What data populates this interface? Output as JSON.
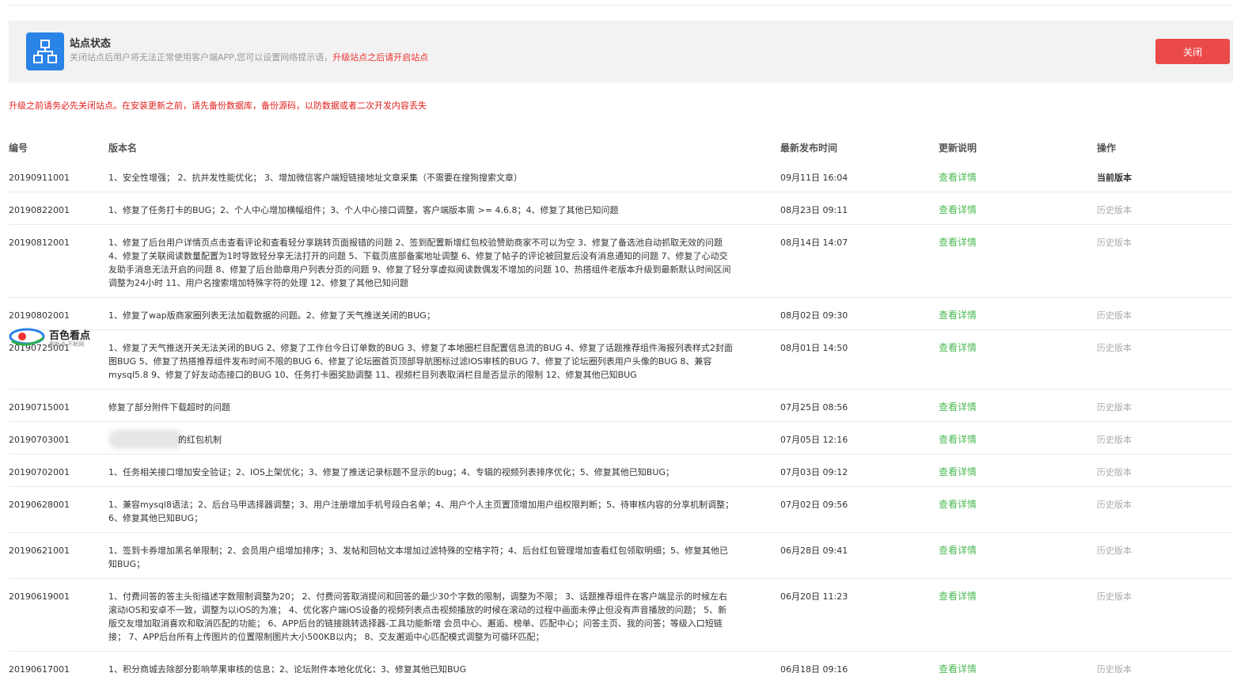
{
  "status": {
    "title": "站点状态",
    "desc": "关闭站点后用户将无法正常使用客户端APP,您可以设置网络提示语，",
    "desc_warn": "升级站点之后请开启站点",
    "close_label": "关闭"
  },
  "warning": "升级之前请务必先关闭站点。在安装更新之前，请先备份数据库，备份源码，以防数据或者二次开发内容丢失",
  "watermark": {
    "text": "百色看点",
    "sub": "看新点 不断网"
  },
  "table": {
    "headers": {
      "id": "编号",
      "name": "版本名",
      "time": "最新发布时间",
      "notes": "更新说明",
      "op": "操作"
    },
    "rows": [
      {
        "id": "20190911001",
        "name": "1、安全性增强； 2、抗并发性能优化； 3、增加微信客户端短链接地址文章采集（不需要在搜狗搜索文章）",
        "time": "09月11日 16:04",
        "link": "查看详情",
        "op": "当前版本"
      },
      {
        "id": "20190822001",
        "name": "1、修复了任务打卡的BUG；2、个人中心增加横幅组件；3、个人中心接口调整，客户端版本需 >= 4.6.8；4、修复了其他已知问题",
        "time": "08月23日 09:11",
        "link": "查看详情",
        "op": "历史版本"
      },
      {
        "id": "20190812001",
        "name": "1、修复了后台用户详情页点击查看评论和查看轻分享跳转页面报错的问题 2、签到配置新增红包校验赞助商家不可以为空 3、修复了备选池自动抓取无效的问题 4、修复了关联阅读数量配置为1时导致轻分享无法打开的问题 5、下载页底部备案地址调整 6、修复了帖子的评论被回复后没有消息通知的问题 7、修复了心动交友助手消息无法开启的问题 8、修复了后台勋章用户列表分页的问题 9、修复了轻分享虚拟阅读数偶发不增加的问题 10、热搭组件老版本升级到最新默认时间区间调整为24小时 11、用户名搜索增加特殊字符的处理 12、修复了其他已知问题",
        "time": "08月14日 14:07",
        "link": "查看详情",
        "op": "历史版本"
      },
      {
        "id": "20190802001",
        "name": "1、修复了wap版商家圈列表无法加载数据的问题。2、修复了天气推送关闭的BUG；",
        "time": "08月02日 09:30",
        "link": "查看详情",
        "op": "历史版本"
      },
      {
        "id": "20190725001",
        "name": "1、修复了天气推送开关无法关闭的BUG 2、修复了工作台今日订单数的BUG 3、修复了本地圈栏目配置信息流的BUG 4、修复了话题推荐组件海报列表样式2封面图BUG 5、修复了热搭推荐组件发布时间不限的BUG 6、修复了论坛圈首页顶部导航图标过滤IOS审核的BUG 7、修复了论坛圈列表用户头像的BUG 8、兼容mysql5.8 9、修复了好友动态接口的BUG 10、任务打卡圈奖励调整 11、视频栏目列表取消栏目是否显示的限制 12、修复其他已知BUG",
        "time": "08月01日 14:50",
        "link": "查看详情",
        "op": "历史版本"
      },
      {
        "id": "20190715001",
        "name": "修复了部分附件下载超时的问题",
        "time": "07月25日 08:56",
        "link": "查看详情",
        "op": "历史版本"
      },
      {
        "id": "20190703001",
        "name": "的红包机制",
        "time": "07月05日 12:16",
        "link": "查看详情",
        "op": "历史版本"
      },
      {
        "id": "20190702001",
        "name": "1、任务相关接口增加安全验证；2、IOS上架优化；3、修复了推送记录标题不显示的bug；4、专辑的视频列表排序优化；5、修复其他已知BUG；",
        "time": "07月03日 09:12",
        "link": "查看详情",
        "op": "历史版本"
      },
      {
        "id": "20190628001",
        "name": "1、兼容mysql8语法；2、后台马甲选择器调整；3、用户注册增加手机号段白名单；4、用户个人主页置顶增加用户组权限判断；5、待审核内容的分享机制调整；6、修复其他已知BUG；",
        "time": "07月02日 09:56",
        "link": "查看详情",
        "op": "历史版本"
      },
      {
        "id": "20190621001",
        "name": "1、签到卡券增加黑名单限制；2、会员用户组增加排序；3、发帖和回帖文本增加过滤特殊的空格字符；4、后台红包管理增加查看红包领取明细；5、修复其他已知BUG；",
        "time": "06月28日 09:41",
        "link": "查看详情",
        "op": "历史版本"
      },
      {
        "id": "20190619001",
        "name": "1、付费问答的答主头衔描述字数限制调整为20； 2、付费问答取消提问和回答的最少30个字数的限制，调整为不限； 3、话题推荐组件在客户端显示的时候左右滚动iOS和安卓不一致，调整为以iOS的为准； 4、优化客户端iOS设备的视频列表点击视频播放的时候在滚动的过程中画面未停止但没有声音播放的问题； 5、新版交友增加取消喜欢和取消匹配的功能； 6、APP后台的链接跳转选择器-工具功能新增 会员中心、邂逅、榜单、匹配中心；问答主页、我的问答；等级入口短链接； 7、APP后台所有上传图片的位置限制图片大小500KB以内； 8、交友邂逅中心匹配模式调整为可循环匹配；",
        "time": "06月20日 11:23",
        "link": "查看详情",
        "op": "历史版本"
      },
      {
        "id": "20190617001",
        "name": "1、积分商城去除部分影响苹果审核的信息；2、论坛附件本地化优化；3、修复其他已知BUG",
        "time": "06月18日 09:16",
        "link": "查看详情",
        "op": "历史版本"
      }
    ]
  }
}
